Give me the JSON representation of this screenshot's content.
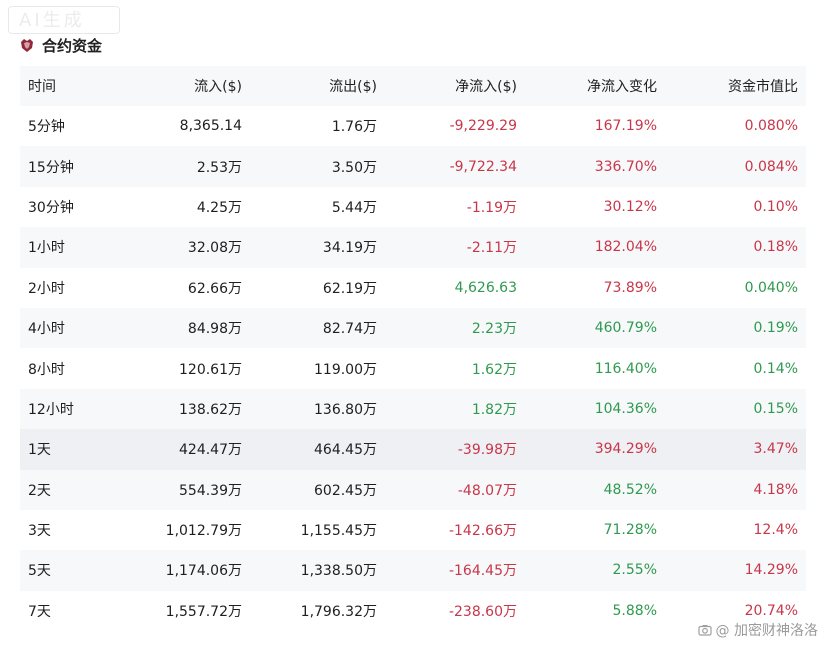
{
  "watermark_top": "AI生成",
  "header": {
    "icon": "contract-logo-icon",
    "title": "合约资金"
  },
  "columns": [
    "时间",
    "流入($)",
    "流出($)",
    "净流入($)",
    "净流入变化",
    "资金市值比"
  ],
  "colors": {
    "negative": "#c8364a",
    "positive": "#2f9a4f"
  },
  "rows": [
    {
      "period": "5分钟",
      "inflow": "8,365.14",
      "outflow": "1.76万",
      "net": "-9,229.29",
      "change": "167.19%",
      "ratio": "0.080%",
      "net_sign": "neg",
      "change_sign": "neg",
      "ratio_sign": "neg"
    },
    {
      "period": "15分钟",
      "inflow": "2.53万",
      "outflow": "3.50万",
      "net": "-9,722.34",
      "change": "336.70%",
      "ratio": "0.084%",
      "net_sign": "neg",
      "change_sign": "neg",
      "ratio_sign": "neg"
    },
    {
      "period": "30分钟",
      "inflow": "4.25万",
      "outflow": "5.44万",
      "net": "-1.19万",
      "change": "30.12%",
      "ratio": "0.10%",
      "net_sign": "neg",
      "change_sign": "neg",
      "ratio_sign": "neg"
    },
    {
      "period": "1小时",
      "inflow": "32.08万",
      "outflow": "34.19万",
      "net": "-2.11万",
      "change": "182.04%",
      "ratio": "0.18%",
      "net_sign": "neg",
      "change_sign": "neg",
      "ratio_sign": "neg"
    },
    {
      "period": "2小时",
      "inflow": "62.66万",
      "outflow": "62.19万",
      "net": "4,626.63",
      "change": "73.89%",
      "ratio": "0.040%",
      "net_sign": "pos",
      "change_sign": "neg",
      "ratio_sign": "pos"
    },
    {
      "period": "4小时",
      "inflow": "84.98万",
      "outflow": "82.74万",
      "net": "2.23万",
      "change": "460.79%",
      "ratio": "0.19%",
      "net_sign": "pos",
      "change_sign": "pos",
      "ratio_sign": "pos"
    },
    {
      "period": "8小时",
      "inflow": "120.61万",
      "outflow": "119.00万",
      "net": "1.62万",
      "change": "116.40%",
      "ratio": "0.14%",
      "net_sign": "pos",
      "change_sign": "pos",
      "ratio_sign": "pos"
    },
    {
      "period": "12小时",
      "inflow": "138.62万",
      "outflow": "136.80万",
      "net": "1.82万",
      "change": "104.36%",
      "ratio": "0.15%",
      "net_sign": "pos",
      "change_sign": "pos",
      "ratio_sign": "pos"
    },
    {
      "period": "1天",
      "inflow": "424.47万",
      "outflow": "464.45万",
      "net": "-39.98万",
      "change": "394.29%",
      "ratio": "3.47%",
      "net_sign": "neg",
      "change_sign": "neg",
      "ratio_sign": "neg"
    },
    {
      "period": "2天",
      "inflow": "554.39万",
      "outflow": "602.45万",
      "net": "-48.07万",
      "change": "48.52%",
      "ratio": "4.18%",
      "net_sign": "neg",
      "change_sign": "pos",
      "ratio_sign": "neg"
    },
    {
      "period": "3天",
      "inflow": "1,012.79万",
      "outflow": "1,155.45万",
      "net": "-142.66万",
      "change": "71.28%",
      "ratio": "12.4%",
      "net_sign": "neg",
      "change_sign": "pos",
      "ratio_sign": "neg"
    },
    {
      "period": "5天",
      "inflow": "1,174.06万",
      "outflow": "1,338.50万",
      "net": "-164.45万",
      "change": "2.55%",
      "ratio": "14.29%",
      "net_sign": "neg",
      "change_sign": "pos",
      "ratio_sign": "neg"
    },
    {
      "period": "7天",
      "inflow": "1,557.72万",
      "outflow": "1,796.32万",
      "net": "-238.60万",
      "change": "5.88%",
      "ratio": "20.74%",
      "net_sign": "neg",
      "change_sign": "pos",
      "ratio_sign": "neg"
    }
  ],
  "watermark_bottom": {
    "icon": "camera-icon",
    "text": "@ 加密财神洛洛"
  }
}
